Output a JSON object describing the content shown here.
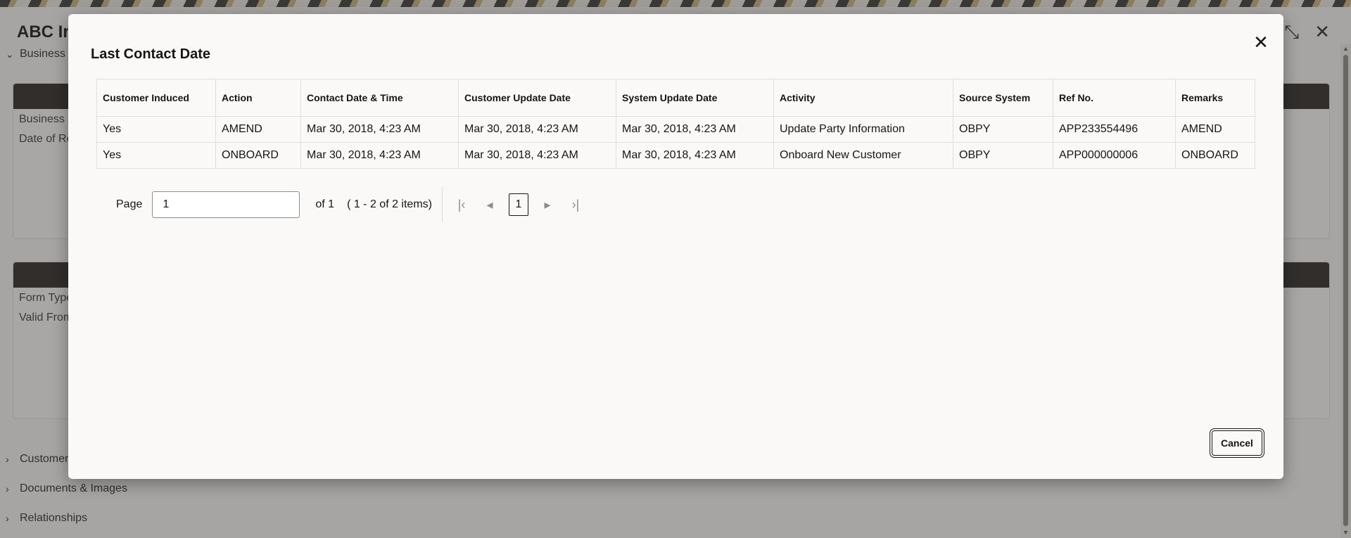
{
  "background": {
    "app_title": "ABC In",
    "sections": [
      {
        "label": "Business I",
        "state": "expanded"
      },
      {
        "label": "Customer",
        "state": "collapsed"
      },
      {
        "label": "Documents & Images",
        "state": "collapsed"
      },
      {
        "label": "Relationships",
        "state": "collapsed"
      }
    ],
    "card1_fields": [
      "Business N",
      "Date of Re"
    ],
    "card2_fields": [
      "Form Type",
      "Valid From"
    ],
    "icons": {
      "collapse": "compress-icon",
      "close": "close-icon"
    }
  },
  "modal": {
    "title": "Last Contact Date",
    "columns": [
      "Customer Induced",
      "Action",
      "Contact Date & Time",
      "Customer Update Date",
      "System Update Date",
      "Activity",
      "Source System",
      "Ref No.",
      "Remarks"
    ],
    "rows": [
      [
        "Yes",
        "AMEND",
        "Mar 30, 2018, 4:23 AM",
        "Mar 30, 2018, 4:23 AM",
        "Mar 30, 2018, 4:23 AM",
        "Update Party Information",
        "OBPY",
        "APP233554496",
        "AMEND"
      ],
      [
        "Yes",
        "ONBOARD",
        "Mar 30, 2018, 4:23 AM",
        "Mar 30, 2018, 4:23 AM",
        "Mar 30, 2018, 4:23 AM",
        "Onboard New Customer",
        "OBPY",
        "APP000000006",
        "ONBOARD"
      ]
    ],
    "pagination": {
      "page_label": "Page",
      "page_value": "1",
      "of_label": "of 1",
      "items_label": "( 1 - 2 of 2 items)",
      "current_page": "1"
    },
    "cancel_label": "Cancel"
  }
}
